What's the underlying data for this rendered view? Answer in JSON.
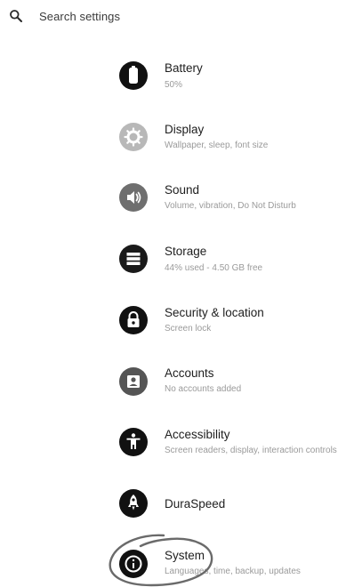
{
  "search": {
    "placeholder": "Search settings",
    "icon": "search-icon"
  },
  "settings": [
    {
      "key": "battery",
      "title": "Battery",
      "subtitle": "50%",
      "icon": "battery-icon"
    },
    {
      "key": "display",
      "title": "Display",
      "subtitle": "Wallpaper, sleep, font size",
      "icon": "display-icon"
    },
    {
      "key": "sound",
      "title": "Sound",
      "subtitle": "Volume, vibration, Do Not Disturb",
      "icon": "sound-icon"
    },
    {
      "key": "storage",
      "title": "Storage",
      "subtitle": "44% used - 4.50 GB free",
      "icon": "storage-icon"
    },
    {
      "key": "security",
      "title": "Security & location",
      "subtitle": "Screen lock",
      "icon": "lock-icon"
    },
    {
      "key": "accounts",
      "title": "Accounts",
      "subtitle": "No accounts added",
      "icon": "account-icon"
    },
    {
      "key": "accessibility",
      "title": "Accessibility",
      "subtitle": "Screen readers, display, interaction controls",
      "icon": "accessibility-icon"
    },
    {
      "key": "duraspeed",
      "title": "DuraSpeed",
      "subtitle": "",
      "icon": "rocket-icon"
    },
    {
      "key": "system",
      "title": "System",
      "subtitle": "Languages, time, backup, updates",
      "icon": "info-icon"
    }
  ],
  "colors": {
    "icon_dark": "#111111",
    "icon_gray": "#7a7a7a",
    "icon_light": "#b5b5b5",
    "title": "#1e1e1e",
    "subtitle": "#9a9a9a",
    "highlight_circle": "#6a6a6a"
  }
}
